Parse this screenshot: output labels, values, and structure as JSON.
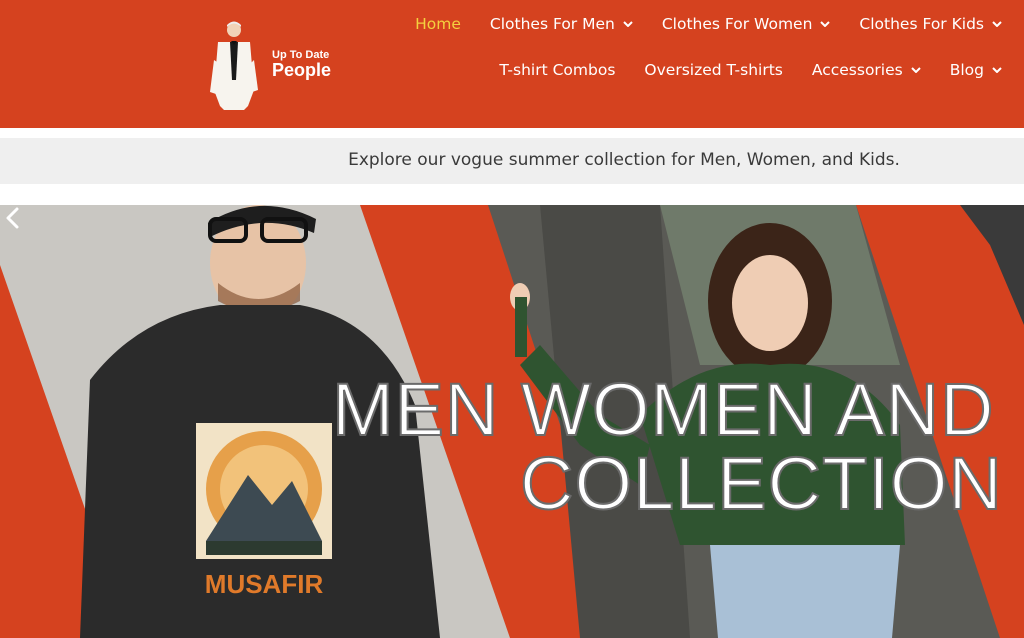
{
  "brand": {
    "line1": "Up To Date",
    "line2": "People"
  },
  "nav": {
    "row1": [
      {
        "label": "Home",
        "active": true,
        "dropdown": false
      },
      {
        "label": "Clothes For Men",
        "active": false,
        "dropdown": true
      },
      {
        "label": "Clothes For Women",
        "active": false,
        "dropdown": true
      },
      {
        "label": "Clothes For Kids",
        "active": false,
        "dropdown": true
      }
    ],
    "row2": [
      {
        "label": "T-shirt Combos",
        "dropdown": false
      },
      {
        "label": "Oversized T-shirts",
        "dropdown": false
      },
      {
        "label": "Accessories",
        "dropdown": true
      },
      {
        "label": "Blog",
        "dropdown": true
      }
    ]
  },
  "tagline": "Explore our vogue summer collection for Men, Women, and Kids.",
  "hero": {
    "title_line1": "MEN WOMEN AND",
    "title_line2": "COLLECTION",
    "shirt_print": "MUSAFIR",
    "prev_icon": "chevron-left-icon"
  },
  "colors": {
    "brand_orange": "#d5421f",
    "active_nav": "#f4d03f",
    "tagline_bg": "#efefef",
    "tagline_text": "#3a3a3a"
  }
}
